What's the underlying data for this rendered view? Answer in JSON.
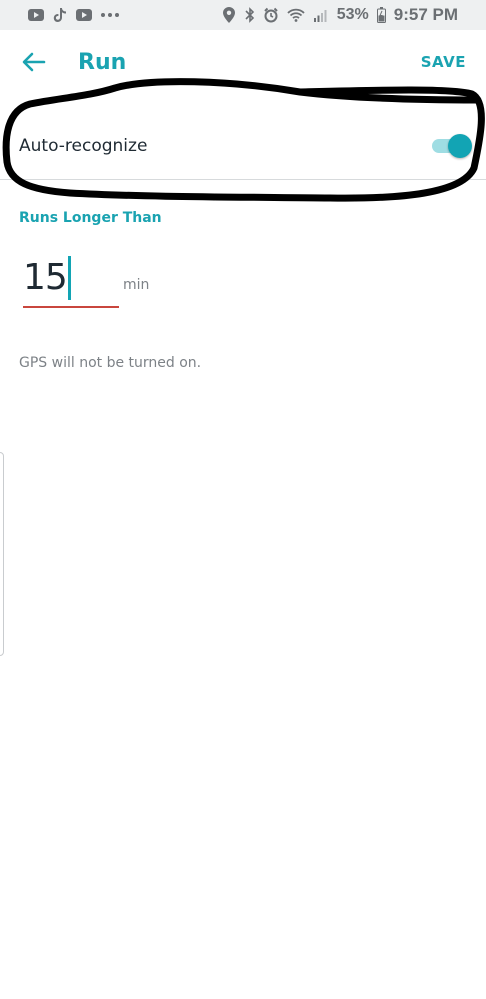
{
  "status_bar": {
    "battery": "53%",
    "time": "9:57 PM",
    "left_icons": [
      "youtube-icon",
      "tiktok-icon",
      "youtube-icon",
      "more-icon"
    ],
    "right_icons": [
      "location-icon",
      "bluetooth-icon",
      "alarm-icon",
      "wifi-icon",
      "signal-icon",
      "battery-icon"
    ]
  },
  "header": {
    "title": "Run",
    "save_label": "SAVE",
    "back_icon": "arrow-left-icon"
  },
  "auto_recognize": {
    "label": "Auto-recognize",
    "enabled": true
  },
  "duration": {
    "section_label": "Runs Longer Than",
    "value": "15",
    "unit": "min"
  },
  "gps_note": "GPS will not be turned on.",
  "colors": {
    "accent": "#1aa3b1",
    "toggle_thumb": "#12a4b4",
    "toggle_track": "#9fdde3",
    "error_underline": "#c9463d",
    "annotation": "#000000"
  }
}
